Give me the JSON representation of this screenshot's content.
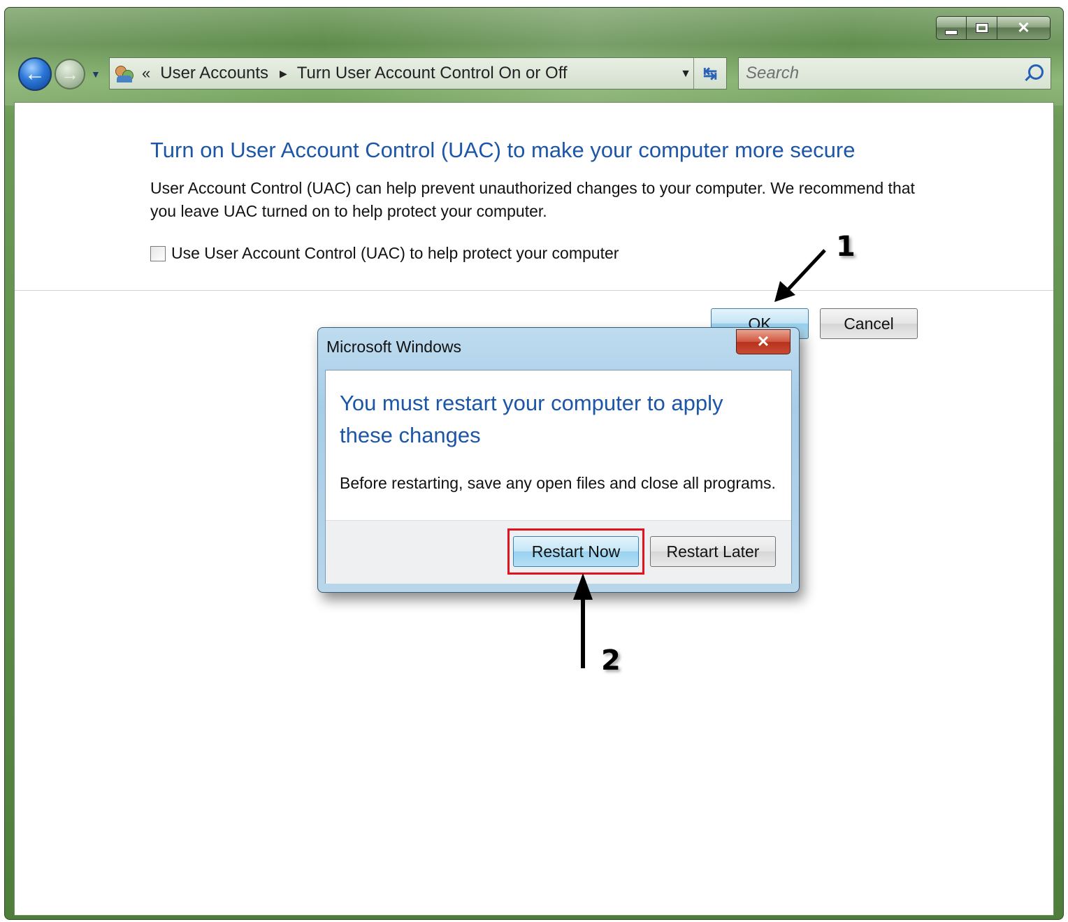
{
  "window": {
    "address": {
      "chevron": "«",
      "crumb1": "User Accounts",
      "crumb2": "Turn User Account Control On or Off"
    },
    "search": {
      "placeholder": "Search"
    }
  },
  "content": {
    "title": "Turn on User Account Control (UAC) to make your computer more secure",
    "description": "User Account Control (UAC) can help prevent unauthorized changes to your computer.  We recommend that you leave UAC turned on to help protect your computer.",
    "checkbox_label": "Use User Account Control (UAC) to help protect your computer",
    "checkbox_checked": false,
    "ok_label": "OK",
    "cancel_label": "Cancel"
  },
  "dialog": {
    "title": "Microsoft Windows",
    "heading": "You must restart your computer to apply these changes",
    "text": "Before restarting, save any open files and close all programs.",
    "restart_now_label": "Restart Now",
    "restart_later_label": "Restart Later"
  },
  "annotations": {
    "step1": "1",
    "step2": "2",
    "arrow_color": "#000000",
    "highlight_color": "#e0141e"
  },
  "icons": [
    "minimize-icon",
    "maximize-icon",
    "close-icon",
    "back-arrow-icon",
    "forward-arrow-icon",
    "user-accounts-icon",
    "refresh-icon",
    "search-icon"
  ]
}
